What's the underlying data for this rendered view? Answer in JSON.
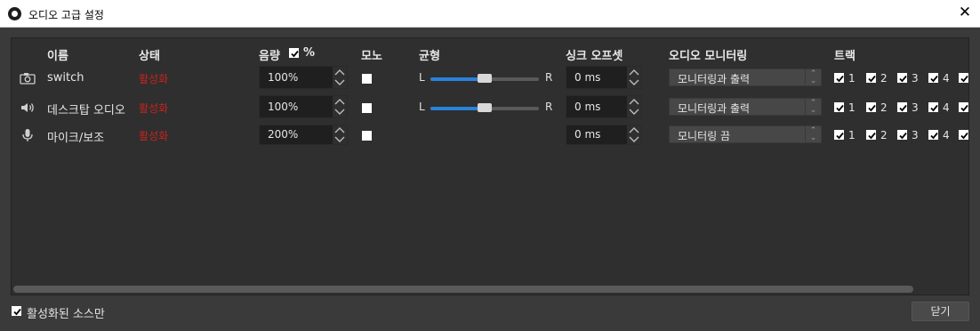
{
  "window": {
    "title": "오디오 고급 설정",
    "close_icon": "close-icon"
  },
  "headers": {
    "name": "이름",
    "status": "상태",
    "volume": "음량",
    "volume_unit": "%",
    "mono": "모노",
    "balance": "균형",
    "sync_offset": "싱크 오프셋",
    "monitoring": "오디오 모니터링",
    "tracks": "트랙"
  },
  "rows": [
    {
      "icon": "camera-icon",
      "name": "switch",
      "status": "활성화",
      "volume": "100%",
      "mono": false,
      "balance": {
        "left": "L",
        "right": "R",
        "value": 0.5
      },
      "sync_offset": "0 ms",
      "monitoring": "모니터링과 출력",
      "tracks": [
        "1",
        "2",
        "3",
        "4"
      ]
    },
    {
      "icon": "speaker-icon",
      "name": "데스크탑 오디오",
      "status": "활성화",
      "volume": "100%",
      "mono": false,
      "balance": {
        "left": "L",
        "right": "R",
        "value": 0.5
      },
      "sync_offset": "0 ms",
      "monitoring": "모니터링과 출력",
      "tracks": [
        "1",
        "2",
        "3",
        "4"
      ]
    },
    {
      "icon": "microphone-icon",
      "name": "마이크/보조",
      "status": "활성화",
      "volume": "200%",
      "mono": false,
      "sync_offset": "0 ms",
      "monitoring": "모니터링 끔",
      "tracks": [
        "1",
        "2",
        "3",
        "4"
      ]
    }
  ],
  "footer": {
    "active_only_label": "활성화된 소스만",
    "active_only_checked": true,
    "close_label": "닫기"
  },
  "colors": {
    "status": "#c8231e",
    "accent": "#2a82da",
    "background": "#3a3a3a"
  }
}
